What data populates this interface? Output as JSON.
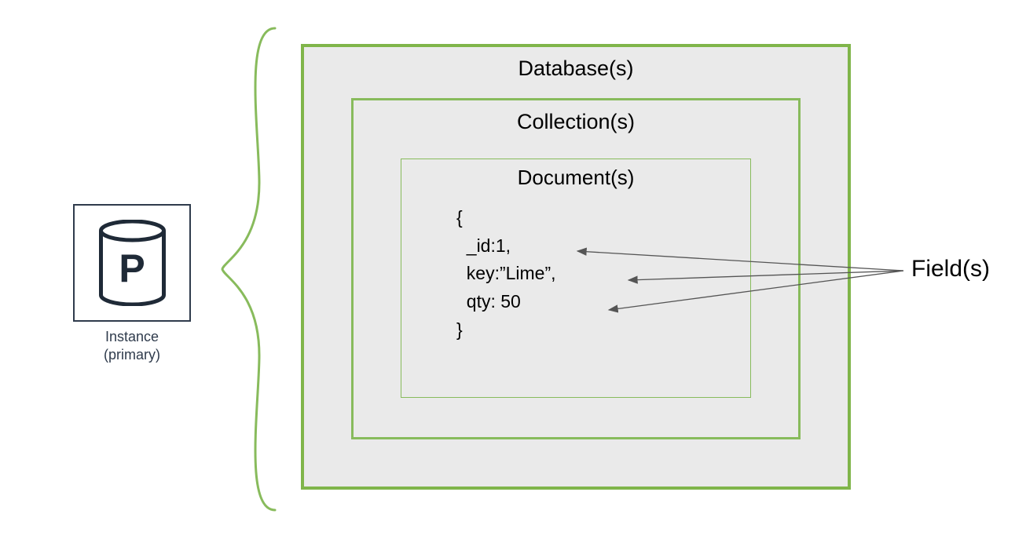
{
  "instance": {
    "letter": "P",
    "caption_line1": "Instance",
    "caption_line2": "(primary)"
  },
  "boxes": {
    "database_label": "Database(s)",
    "collection_label": "Collection(s)",
    "document_label": "Document(s)"
  },
  "document": {
    "open": "{",
    "field1": "  _id:1,",
    "field2": "  key:”Lime”,",
    "field3": "  qty: 50",
    "close": "}"
  },
  "fields_label": "Field(s)"
}
